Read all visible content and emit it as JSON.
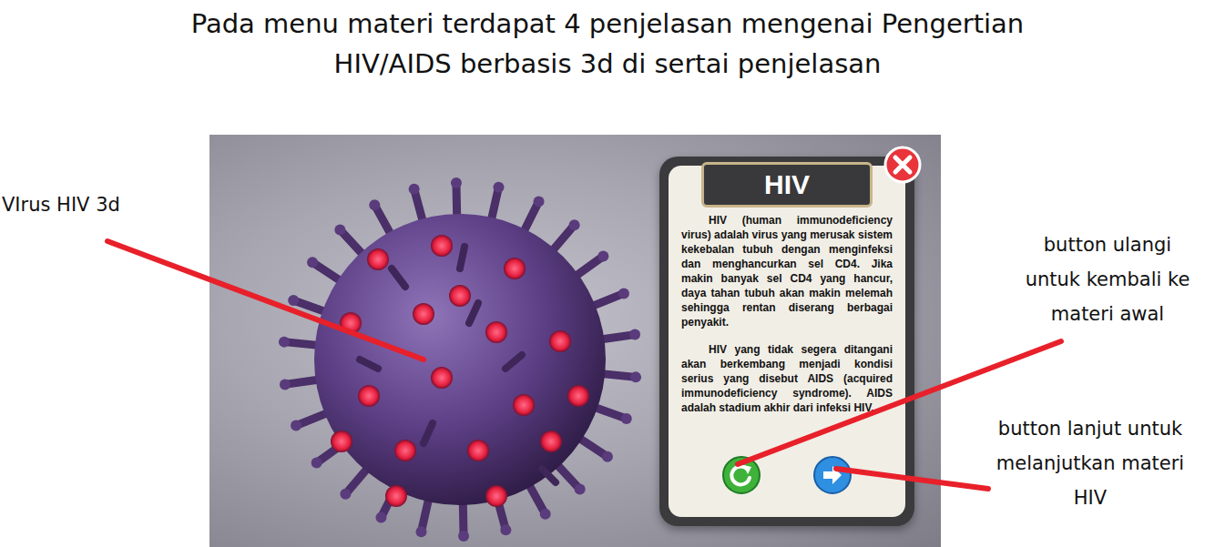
{
  "title_lines": [
    "Pada menu materi terdapat 4 penjelasan mengenai Pengertian",
    "HIV/AIDS berbasis 3d di sertai penjelasan"
  ],
  "panel": {
    "title": "HIV",
    "paragraphs": [
      "HIV (human immunodeficiency virus) adalah virus yang merusak sistem kekebalan tubuh dengan menginfeksi dan menghancurkan sel CD4. Jika makin banyak sel CD4 yang hancur, daya tahan tubuh akan makin melemah sehingga rentan diserang berbagai penyakit.",
      "HIV yang tidak segera ditangani akan berkembang menjadi kondisi serius yang disebut AIDS (acquired immunodeficiency syndrome). AIDS adalah stadium akhir dari infeksi HIV."
    ]
  },
  "annotations": [
    {
      "lines": [
        "VIrus HIV 3d"
      ]
    },
    {
      "lines": [
        "button ulangi",
        "untuk kembali ke",
        "materi awal"
      ]
    },
    {
      "lines": [
        "button lanjut untuk",
        "melanjutkan materi",
        "HIV"
      ]
    }
  ]
}
